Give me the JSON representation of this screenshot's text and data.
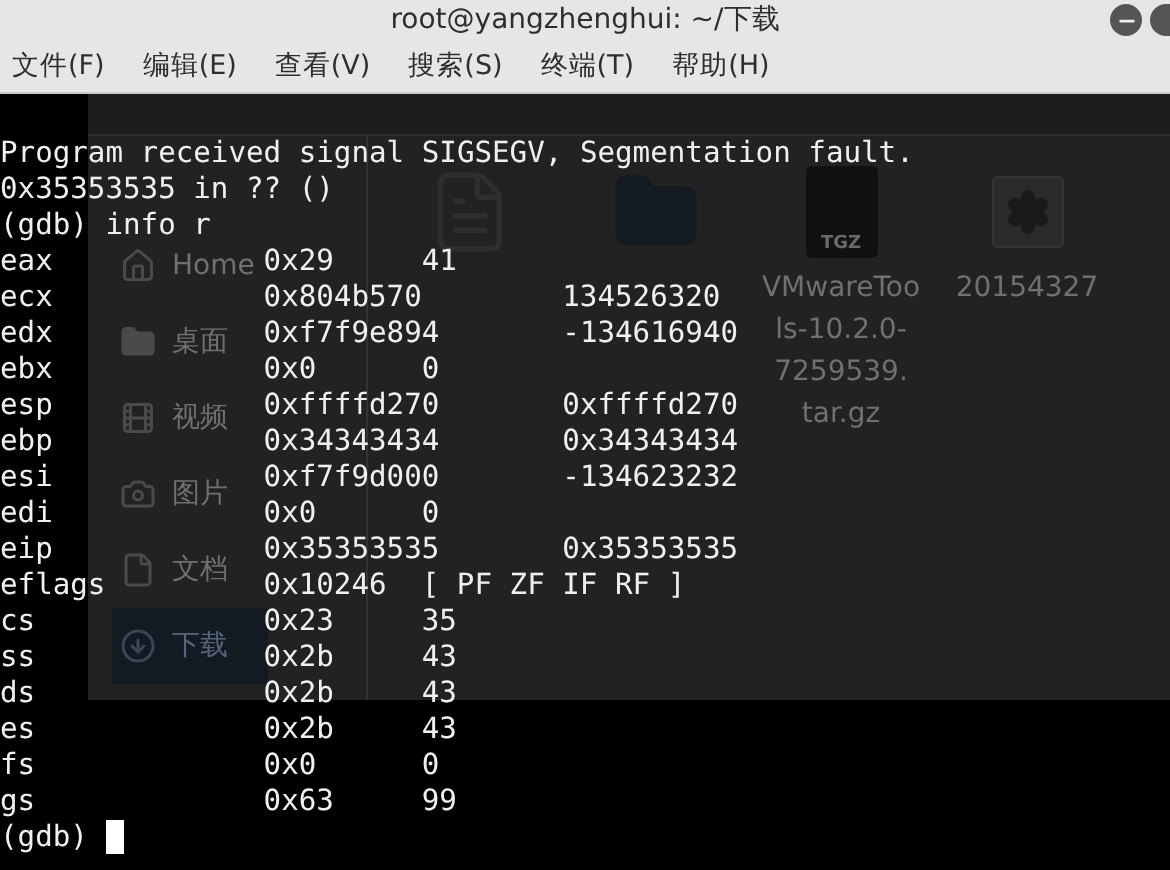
{
  "window": {
    "title": "root@yangzhenghui: ~/下载"
  },
  "menu": [
    {
      "label": "文件(F)"
    },
    {
      "label": "编辑(E)"
    },
    {
      "label": "查看(V)"
    },
    {
      "label": "搜索(S)"
    },
    {
      "label": "终端(T)"
    },
    {
      "label": "帮助(H)"
    }
  ],
  "background_window": {
    "sidebar": [
      {
        "kind": "home",
        "label": "Home",
        "selected": false
      },
      {
        "kind": "folder",
        "label": "桌面",
        "selected": false
      },
      {
        "kind": "video",
        "label": "视频",
        "selected": false
      },
      {
        "kind": "picture",
        "label": "图片",
        "selected": false
      },
      {
        "kind": "document",
        "label": "文档",
        "selected": false
      },
      {
        "kind": "download",
        "label": "下载",
        "selected": true
      }
    ],
    "files": [
      {
        "kind": "document"
      },
      {
        "kind": "folder"
      },
      {
        "kind": "archive",
        "badge": "TGZ",
        "name": [
          "VMwareToo",
          "ls-10.2.0-",
          "7259539.",
          "tar.gz"
        ]
      },
      {
        "kind": "settings",
        "name": [
          "20154327"
        ]
      }
    ]
  },
  "terminal": {
    "lines": [
      "Program received signal SIGSEGV, Segmentation fault.",
      "0x35353535 in ?? ()",
      "(gdb) info r"
    ],
    "registers": [
      {
        "name": "eax",
        "raw": "0x29",
        "value": "41"
      },
      {
        "name": "ecx",
        "raw": "0x804b570",
        "value": "134526320"
      },
      {
        "name": "edx",
        "raw": "0xf7f9e894",
        "value": "-134616940"
      },
      {
        "name": "ebx",
        "raw": "0x0",
        "value": "0"
      },
      {
        "name": "esp",
        "raw": "0xffffd270",
        "value": "0xffffd270"
      },
      {
        "name": "ebp",
        "raw": "0x34343434",
        "value": "0x34343434"
      },
      {
        "name": "esi",
        "raw": "0xf7f9d000",
        "value": "-134623232"
      },
      {
        "name": "edi",
        "raw": "0x0",
        "value": "0"
      },
      {
        "name": "eip",
        "raw": "0x35353535",
        "value": "0x35353535"
      },
      {
        "name": "eflags",
        "raw": "0x10246",
        "value": "[ PF ZF IF RF ]"
      },
      {
        "name": "cs",
        "raw": "0x23",
        "value": "35"
      },
      {
        "name": "ss",
        "raw": "0x2b",
        "value": "43"
      },
      {
        "name": "ds",
        "raw": "0x2b",
        "value": "43"
      },
      {
        "name": "es",
        "raw": "0x2b",
        "value": "43"
      },
      {
        "name": "fs",
        "raw": "0x0",
        "value": "0"
      },
      {
        "name": "gs",
        "raw": "0x63",
        "value": "99"
      }
    ],
    "prompt": "(gdb)"
  }
}
